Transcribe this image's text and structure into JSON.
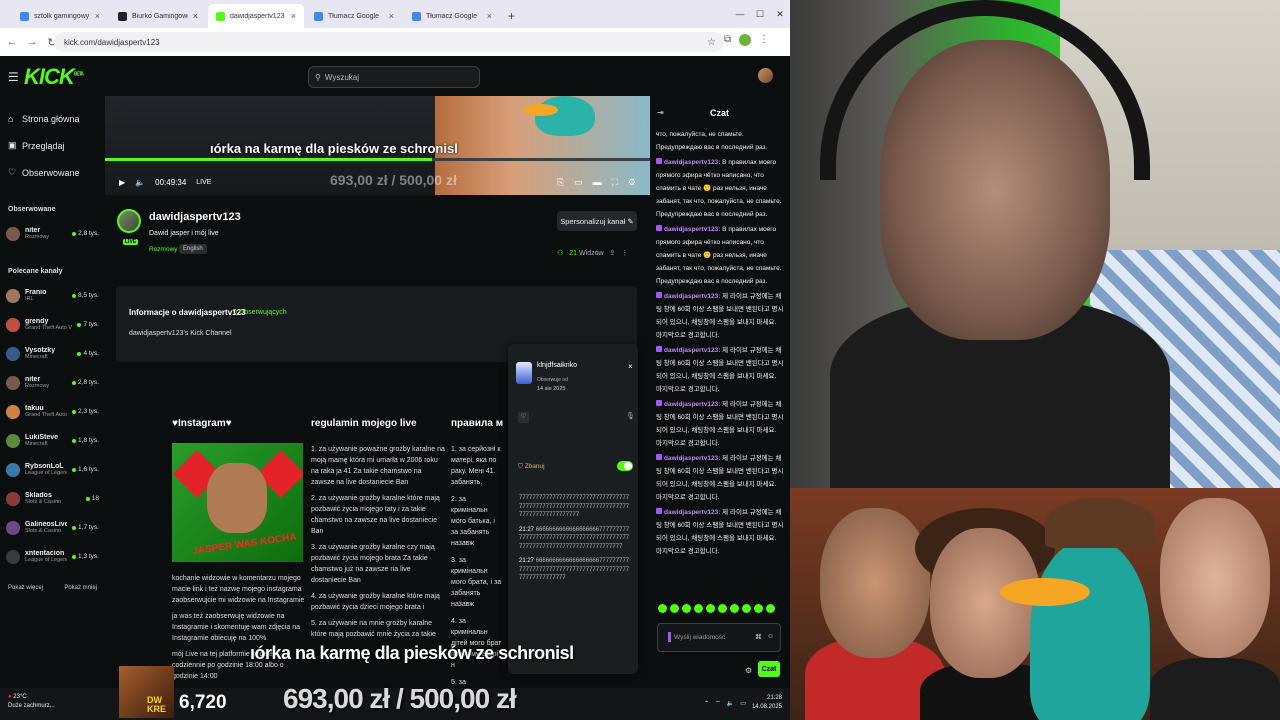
{
  "browser": {
    "tabs": [
      {
        "label": "sztolk gamingowy - Szukaj w G",
        "color": "#4285f4",
        "active": false
      },
      {
        "label": "Biurko Gamingowe Huzaro Hero",
        "color": "#222222",
        "active": false
      },
      {
        "label": "dawidjaspertv123 Stream - Wat",
        "color": "#53fc18",
        "active": true
      },
      {
        "label": "Tłumacz Google",
        "color": "#4285f4",
        "active": false
      },
      {
        "label": "Tłumacz Google",
        "color": "#4285f4",
        "active": false
      }
    ],
    "new_tab": "+",
    "url": "kick.com/dawidjaspertv123"
  },
  "header": {
    "logo": "KICK",
    "logo_sup": "BETA",
    "search_placeholder": "Wyszukaj"
  },
  "sidebar": {
    "nav": [
      {
        "label": "Strona główna",
        "icon": "⌂"
      },
      {
        "label": "Przeglądaj",
        "icon": "▣"
      },
      {
        "label": "Obserwowane",
        "icon": "♡"
      }
    ],
    "followed_title": "Obserwowane",
    "followed": [
      {
        "name": "niter",
        "category": "Rozmowy",
        "viewers": "2,8 tys.",
        "color": "#7a5a4a"
      }
    ],
    "recommended_title": "Polecane kanały",
    "recommended": [
      {
        "name": "Franio",
        "category": "IRL",
        "viewers": "8,5 tys.",
        "color": "#a0785a"
      },
      {
        "name": "grendy",
        "category": "Grand Theft Auto V",
        "viewers": "7 tys.",
        "color": "#c05040"
      },
      {
        "name": "Vysotzky",
        "category": "Minecraft",
        "viewers": "4 tys.",
        "color": "#3a5a8a"
      },
      {
        "name": "niter",
        "category": "Rozmowy",
        "viewers": "2,8 tys.",
        "color": "#7a5a4a"
      },
      {
        "name": "takuu",
        "category": "Grand Theft Auto ...",
        "viewers": "2,3 tys.",
        "color": "#d08040"
      },
      {
        "name": "LukiSteve",
        "category": "Minecraft",
        "viewers": "1,8 tys.",
        "color": "#5a8a3a"
      },
      {
        "name": "RybsonLoL",
        "category": "League of Legends",
        "viewers": "1,6 tys.",
        "color": "#3a7aaa"
      },
      {
        "name": "Sklados",
        "category": "Slots & Casino",
        "viewers": "18",
        "color": "#8a3a3a"
      },
      {
        "name": "GalineosLive",
        "category": "Slots & Casino",
        "viewers": "1,7 tys.",
        "color": "#6a4a8a"
      },
      {
        "name": "xntentacion",
        "category": "League of Legends",
        "viewers": "1,3 tys.",
        "color": "#3a3a3a"
      }
    ],
    "show_more": "Pokaż więcej",
    "show_less": "Pokaż mniej"
  },
  "video": {
    "overlay_text": "ıórka na karmę dla piesków ze schronisl",
    "time": "00:49:34",
    "live": "LIVE",
    "amount": "693,00 zł / 500,00 zł",
    "progress": 0.6
  },
  "channel": {
    "name": "dawidjaspertv123",
    "title": "Dawid jasper i mój live",
    "category": "Rozmowy",
    "language": "English",
    "live_badge": "LIVE",
    "customize_button": "Spersonalizuj kanał",
    "viewers_count": "21",
    "viewers_label": "Widzów"
  },
  "about": {
    "title": "Informacje o dawidjaspertv123",
    "followers": "0 Obserwujących",
    "description": "dawidjaspertv123's Kick Channel"
  },
  "panels": {
    "instagram_title": "♥Instagram♥",
    "instagram_caption": "JASPER WAS KOCHA",
    "instagram_text": "kochanie widzowie w komentarzu mojego macie link i też nazwę mojego instagrama zaobserwujcie mi widzowie na Instagramie",
    "instagram_text2": "ja was też zaobserwuję widzowie na Instagramie i skomentuję wam zdjęcia na Instagramie obiecuję na 100%",
    "instagram_text3": "mój Live na tej platformie będzie codziennie po godzinie 18:00 albo o godzinie 14:00",
    "rules_title": "regulamin mojego live",
    "rules": [
      "1. za używanie poważne groźby karalne na moją mamę która mi umarła w 2006 roku na raka ja 41 Za takie chamstwo na zawsze na live dostaniecie Ban",
      "2. za używanie groźby karalne które mają pozbawić życia mojego taty i za takie chamstwo na zawsze na live dostaniecie Ban",
      "3. za używanie groźby karalne czy mają pozbawić życia mojego brata Za takie chamstwo już na zawsze na live dostaniecie Ban",
      "4. za używanie groźby karalne które mają pozbawić życia dzieci mojego brata i",
      "5. za używanie na mnie groźby karalne które mają pozbawić mnie życia za takie"
    ],
    "rules2_title": "правила мог",
    "rules2": [
      "1. за серйозні к матері, яка по раку. Мені 41. забанять.",
      "2. за кримінальн мого батька, і за забанять назавж",
      "3. за кримінальн мого брата, і за забанять назавж",
      "4. за кримінальн дітей мого брат прямому ефірі н",
      "5. за кримінальн мене життя, і з"
    ]
  },
  "popup": {
    "username": "klnjdfsaiknko",
    "followed_since": "Obserwuje od",
    "date": "14 sie 2025",
    "close": "×",
    "ban_label": "Zbanuj",
    "messages": [
      {
        "time": "",
        "text": "777777777777777777777777777777777777777777777777777777777777777777777777777777777777"
      },
      {
        "time": "21:27",
        "text": "66666666666666666667777777777777777777777777777777777777777777777777777777777777777777777777"
      },
      {
        "time": "21:27",
        "text": "666666666666666666677777777777777777777777777777777777777777777777777777777"
      }
    ]
  },
  "overlay": {
    "title": "ıórka na karmę dla piesków ze schronisl",
    "amount": "693,00 zł / 500,00 zł",
    "count": "6,720",
    "thumb_text": "DW KRE"
  },
  "taskbar": {
    "temp": "23°C",
    "weather": "Duże zachmurz...",
    "time": "21:28",
    "date": "14.08.2025"
  },
  "chat": {
    "title": "Czat",
    "messages": [
      {
        "user": "",
        "text": "что, пожалуйста, не спамьте. Предупреждаю вас в последний раз."
      },
      {
        "user": "dawidjaspertv123:",
        "text": "В правилах моего прямого эфира чётко написано, что спамить в чате 🙂 раз нельзя, иначе забанят, так что, пожалуйста, не спамьте. Предупреждаю вас в последний раз."
      },
      {
        "user": "dawidjaspertv123:",
        "text": "В правилах моего прямого эфира чётко написано, что спамить в чате 🙂 раз нельзя, иначе забанят, так что, пожалуйста, не спамьте. Предупреждаю вас в последний раз."
      },
      {
        "user": "dawidjaspertv123:",
        "text": "제 라이브 규정에는 채팅 창에 60회 이상 스팸을 보내면 밴된다고 명시되어 있으니, 채팅창에 스팸을 보내지 마세요. 마지막으로 경고합니다."
      },
      {
        "user": "dawidjaspertv123:",
        "text": "제 라이브 규정에는 채팅 창에 60회 이상 스팸을 보내면 밴된다고 명시되어 있으니, 채팅창에 스팸을 보내지 마세요. 마지막으로 경고합니다."
      },
      {
        "user": "dawidjaspertv123:",
        "text": "제 라이브 규정에는 채팅 창에 60회 이상 스팸을 보내면 밴된다고 명시되어 있으니, 채팅창에 스팸을 보내지 마세요. 마지막으로 경고합니다."
      },
      {
        "user": "dawidjaspertv123:",
        "text": "제 라이브 규정에는 채팅 창에 60회 이상 스팸을 보내면 밴된다고 명시되어 있으니, 채팅창에 스팸을 보내지 마세요. 마지막으로 경고합니다."
      },
      {
        "user": "dawidjaspertv123:",
        "text": "제 라이브 규정에는 채팅 창에 60회 이상 스팸을 보내면 밴된다고 명시되어 있으니, 채팅창에 스팸을 보내지 마세요. 마지막으로 경고합니다."
      }
    ],
    "input_placeholder": "Wyślij wiadomość",
    "send": "Czat"
  }
}
